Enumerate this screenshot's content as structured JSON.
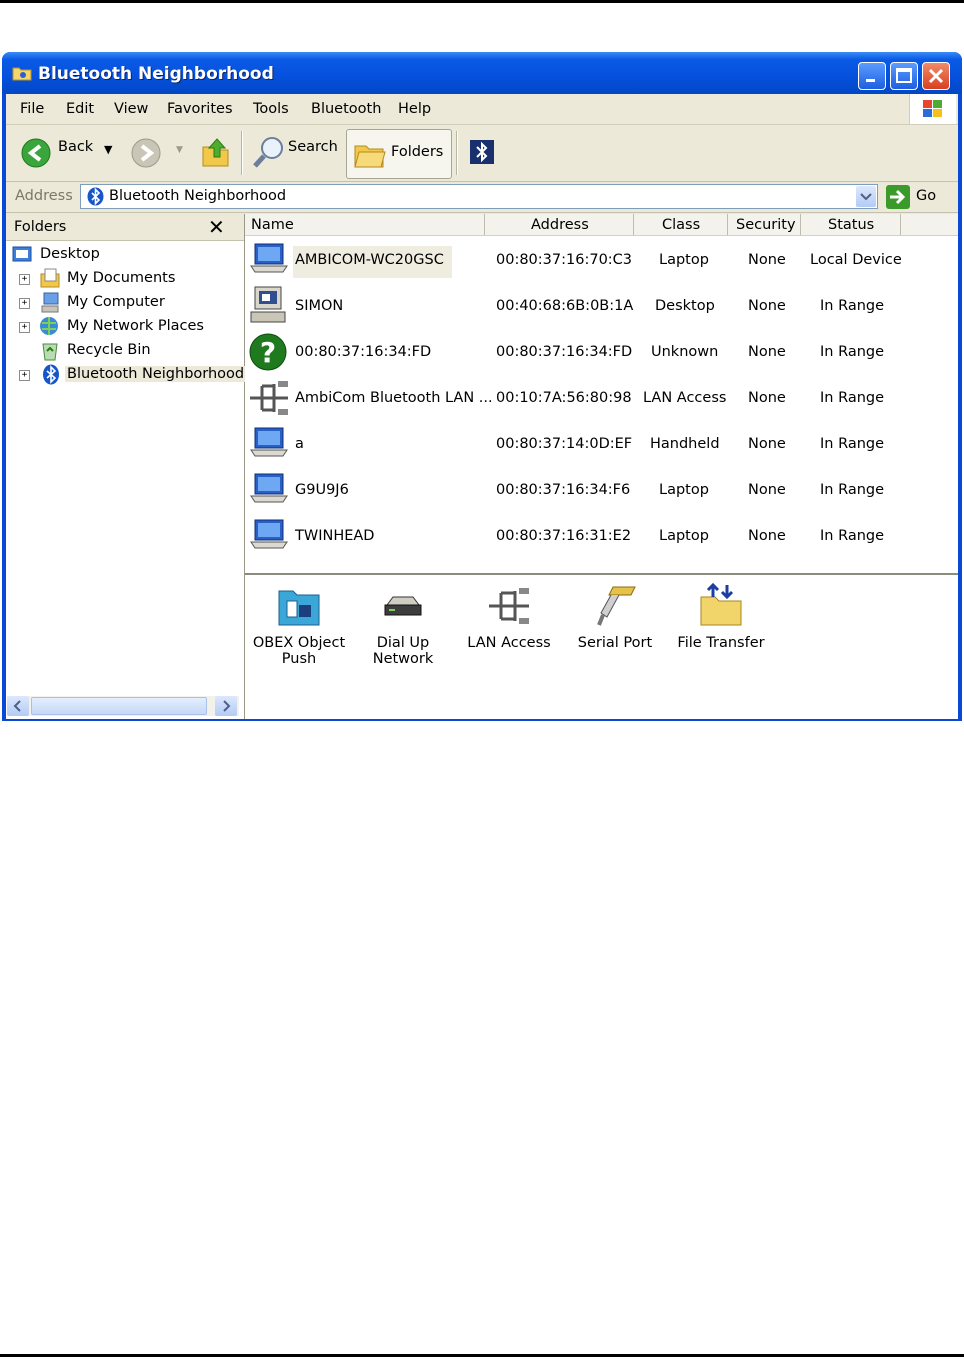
{
  "window": {
    "title": "Bluetooth Neighborhood"
  },
  "menu": [
    "File",
    "Edit",
    "View",
    "Favorites",
    "Tools",
    "Bluetooth",
    "Help"
  ],
  "toolbar": {
    "back": "Back",
    "search": "Search",
    "folders": "Folders"
  },
  "address": {
    "label": "Address",
    "value": "Bluetooth Neighborhood",
    "go": "Go"
  },
  "folders_pane": {
    "title": "Folders",
    "close": "✕",
    "items": [
      {
        "label": "Desktop",
        "icon": "desktop-icon"
      },
      {
        "label": "My Documents",
        "icon": "my-documents-icon"
      },
      {
        "label": "My Computer",
        "icon": "my-computer-icon"
      },
      {
        "label": "My Network Places",
        "icon": "network-places-icon"
      },
      {
        "label": "Recycle Bin",
        "icon": "recycle-bin-icon"
      },
      {
        "label": "Bluetooth Neighborhood",
        "icon": "bluetooth-icon"
      }
    ]
  },
  "list": {
    "columns": [
      "Name",
      "Address",
      "Class",
      "Security",
      "Status"
    ],
    "rows": [
      {
        "name": "AMBICOM-WC20GSC",
        "address": "00:80:37:16:70:C3",
        "class": "Laptop",
        "security": "None",
        "status": "Local Device",
        "icon": "laptop-icon"
      },
      {
        "name": "SIMON",
        "address": "00:40:68:6B:0B:1A",
        "class": "Desktop",
        "security": "None",
        "status": "In Range",
        "icon": "desktop-computer-icon"
      },
      {
        "name": "00:80:37:16:34:FD",
        "address": "00:80:37:16:34:FD",
        "class": "Unknown",
        "security": "None",
        "status": "In Range",
        "icon": "question-icon"
      },
      {
        "name": "AmbiCom Bluetooth LAN ...",
        "address": "00:10:7A:56:80:98",
        "class": "LAN Access",
        "security": "None",
        "status": "In Range",
        "icon": "lan-access-icon"
      },
      {
        "name": "a",
        "address": "00:80:37:14:0D:EF",
        "class": "Handheld",
        "security": "None",
        "status": "In Range",
        "icon": "handheld-icon"
      },
      {
        "name": "G9U9J6",
        "address": "00:80:37:16:34:F6",
        "class": "Laptop",
        "security": "None",
        "status": "In Range",
        "icon": "laptop-icon"
      },
      {
        "name": "TWINHEAD",
        "address": "00:80:37:16:31:E2",
        "class": "Laptop",
        "security": "None",
        "status": "In Range",
        "icon": "laptop-icon"
      }
    ]
  },
  "services": [
    {
      "line1": "OBEX Object",
      "line2": "Push",
      "icon": "obex-push-icon"
    },
    {
      "line1": "Dial Up",
      "line2": "Network",
      "icon": "dial-up-icon"
    },
    {
      "line1": "LAN Access",
      "line2": "",
      "icon": "lan-access-icon"
    },
    {
      "line1": "Serial Port",
      "line2": "",
      "icon": "serial-port-icon"
    },
    {
      "line1": "File Transfer",
      "line2": "",
      "icon": "file-transfer-icon"
    }
  ],
  "colors": {
    "titlebar": "#0550dc",
    "chrome": "#ece9d8",
    "selection": "#efede0"
  }
}
